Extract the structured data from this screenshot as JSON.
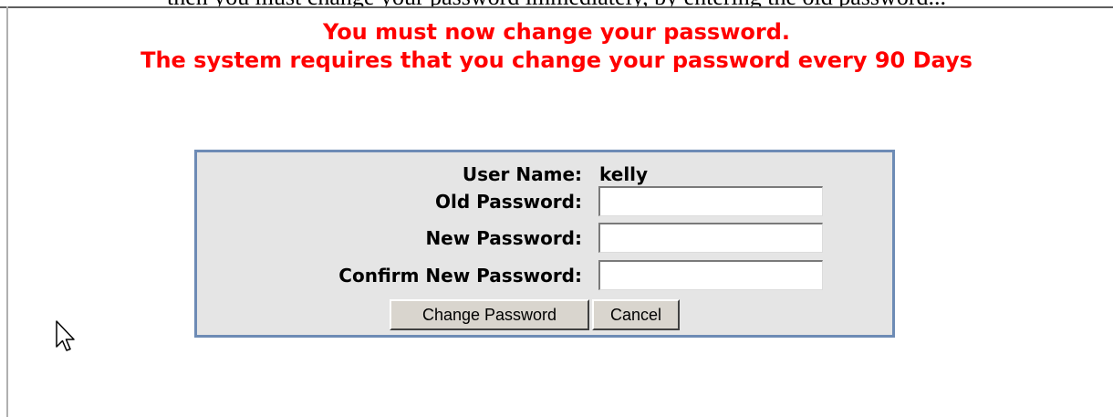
{
  "top_partial_text": "then you must change your password immediately, by entering the old password...",
  "heading": {
    "line1": "You must now change your password.",
    "line2": "The system requires that you change your password every 90 Days"
  },
  "form": {
    "user_name_label": "User Name:",
    "user_name_value": "kelly",
    "old_password_label": "Old Password:",
    "old_password_value": "",
    "new_password_label": "New Password:",
    "new_password_value": "",
    "confirm_password_label": "Confirm New Password:",
    "confirm_password_value": "",
    "change_button_label": "Change Password",
    "cancel_button_label": "Cancel"
  },
  "colors": {
    "heading": "#ff0000",
    "panel_background": "#e5e5e5",
    "panel_border": "#6d8bb5",
    "button_face": "#d9d5ce"
  },
  "icons": {
    "cursor": "mouse-pointer-icon"
  }
}
